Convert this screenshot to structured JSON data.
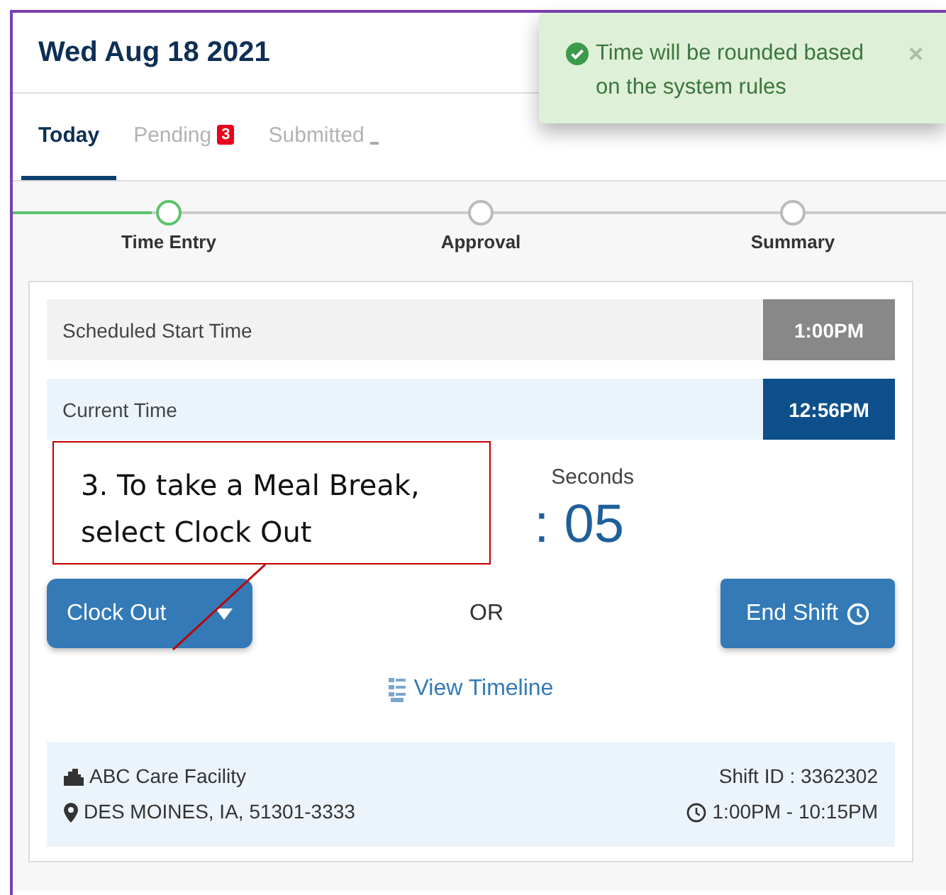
{
  "header": {
    "date": "Wed Aug 18 2021"
  },
  "toast": {
    "message": "Time will be rounded based on the system rules",
    "close": "×"
  },
  "tabs": [
    {
      "label": "Today",
      "selected": true
    },
    {
      "label": "Pending",
      "selected": false,
      "badge": "3"
    },
    {
      "label": "Submitted",
      "selected": false
    }
  ],
  "steps": [
    {
      "label": "Time Entry",
      "selected": true
    },
    {
      "label": "Approval",
      "selected": false
    },
    {
      "label": "Summary",
      "selected": false
    }
  ],
  "times": [
    {
      "label": "Scheduled Start Time",
      "value": "1:00PM",
      "kind": "scheduled"
    },
    {
      "label": "Current Time",
      "value": "12:56PM",
      "kind": "current"
    }
  ],
  "timer": {
    "label": "Seconds",
    "value": ": 05"
  },
  "actions": {
    "clock_out": "Clock Out",
    "or": "OR",
    "end_shift": "End Shift"
  },
  "link": "View Timeline",
  "shift": {
    "facility": "ABC Care Facility",
    "address": "DES MOINES, IA, 51301-3333",
    "shift_id": "Shift ID : 3362302",
    "hours": "1:00PM - 10:15PM"
  },
  "callout": {
    "text": "3. To take a Meal Break, select Clock Out"
  }
}
